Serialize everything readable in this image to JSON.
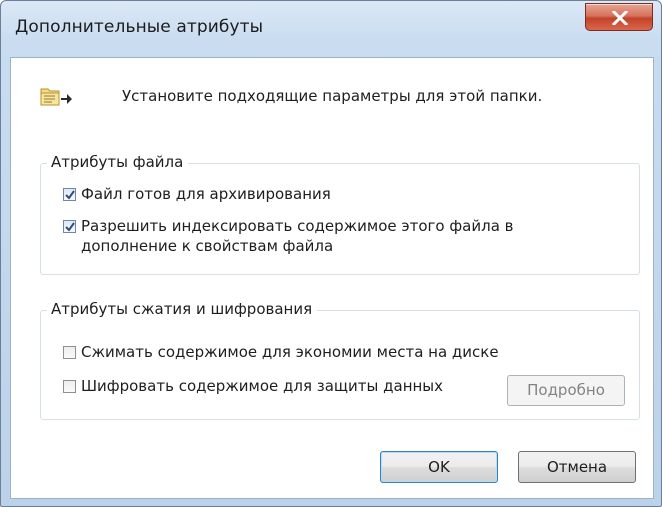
{
  "window": {
    "title": "Дополнительные атрибуты",
    "accent_color": "#c2432a"
  },
  "header": {
    "icon": "folder-attributes-icon",
    "text": "Установите подходящие параметры для этой папки."
  },
  "file_attributes": {
    "legend": "Атрибуты файла",
    "options": [
      {
        "label": "Файл готов для архивирования",
        "checked": true
      },
      {
        "label": "Разрешить индексировать содержимое этого файла в\nдополнение к свойствам файла",
        "checked": true
      }
    ]
  },
  "compression_encryption": {
    "legend": "Атрибуты сжатия и шифрования",
    "options": [
      {
        "label": "Сжимать содержимое для экономии места на диске",
        "checked": false
      },
      {
        "label": "Шифровать содержимое для защиты данных",
        "checked": false
      }
    ],
    "details_label": "Подробно",
    "details_enabled": false
  },
  "buttons": {
    "ok_label": "OK",
    "cancel_label": "Отмена"
  }
}
